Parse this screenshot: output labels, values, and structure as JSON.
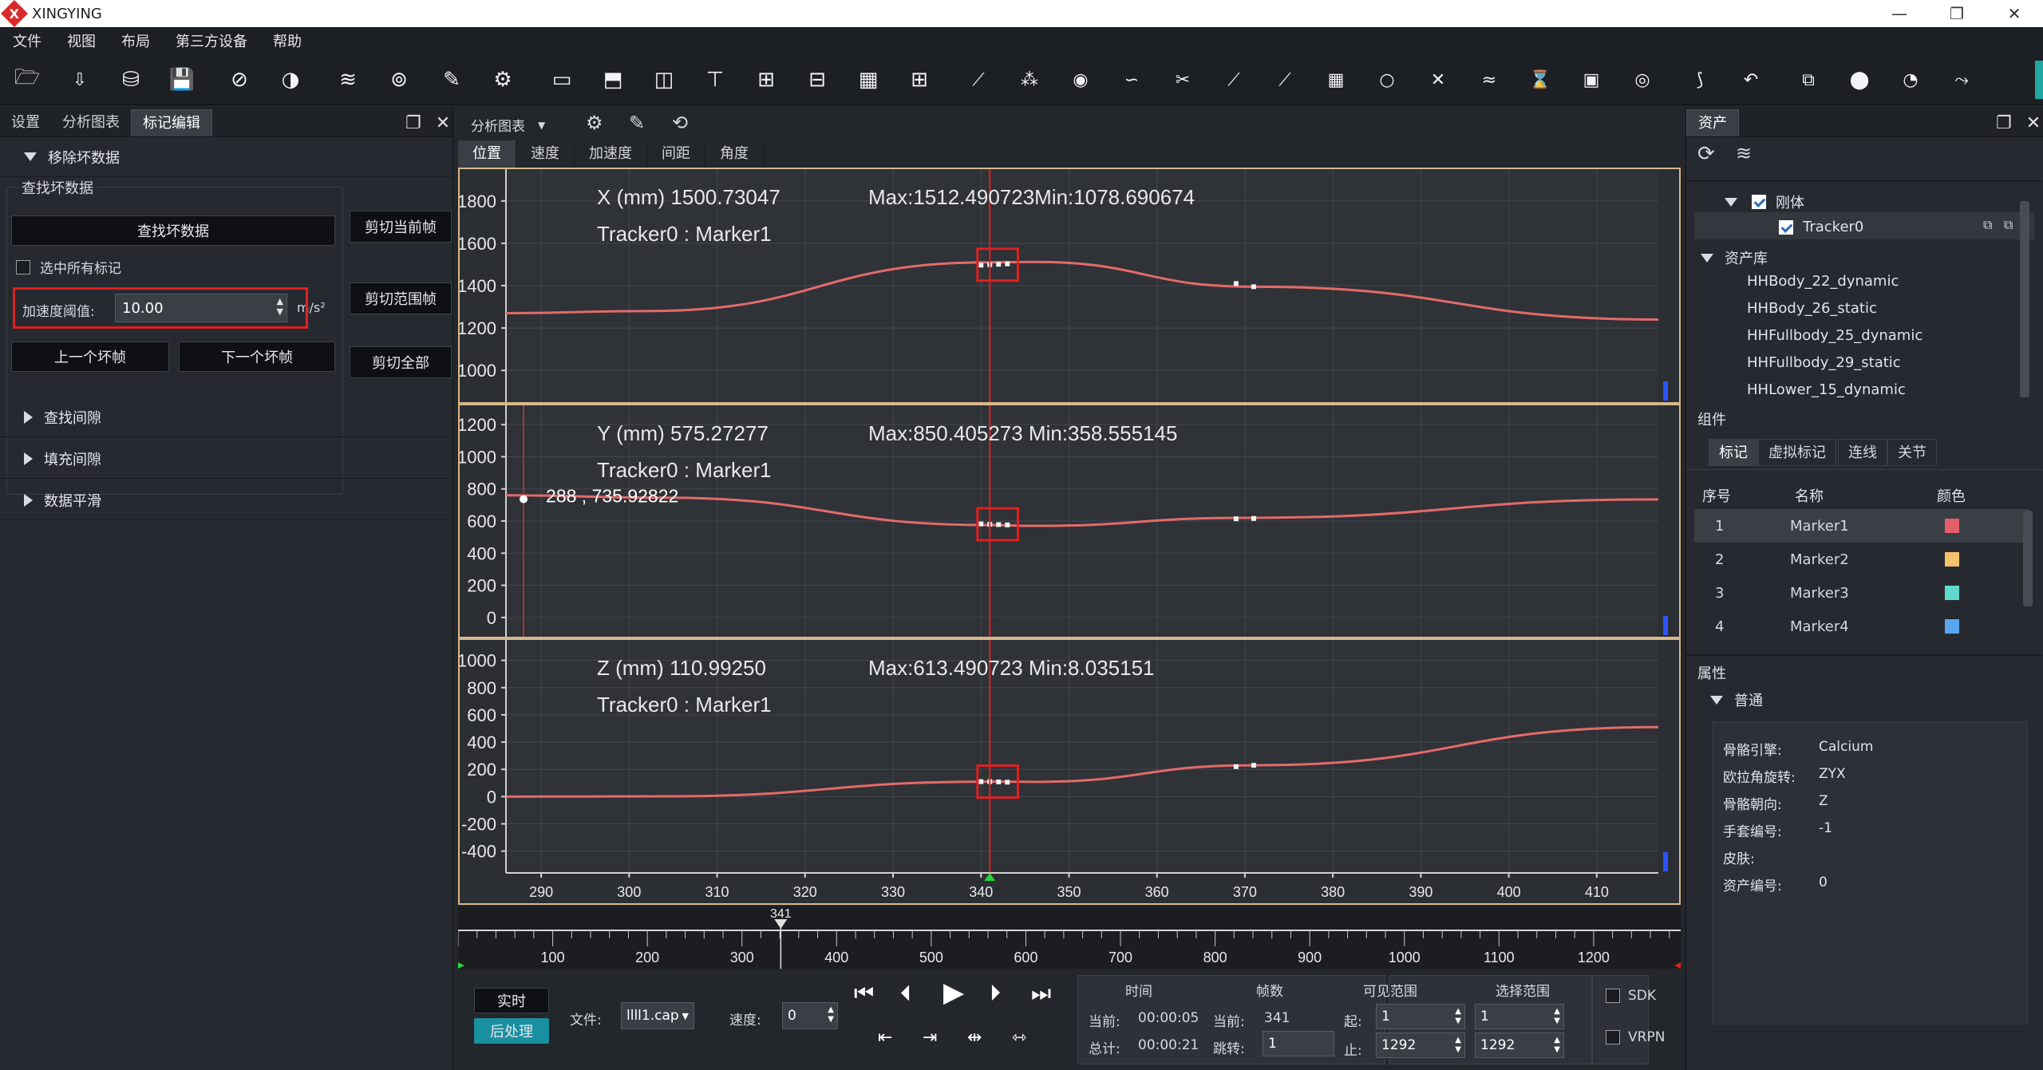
{
  "app": {
    "title": "XINGYING",
    "logo": "X"
  },
  "menu": [
    "文件",
    "视图",
    "布局",
    "第三方设备",
    "帮助"
  ],
  "window_controls": [
    "—",
    "❐",
    "✕"
  ],
  "left_panel": {
    "tabs": [
      "设置",
      "分析图表",
      "标记编辑"
    ],
    "active_tab": 2,
    "remove_bad_section": "移除坏数据",
    "find_bad_group": "查找坏数据",
    "find_bad_button": "查找坏数据",
    "select_all_label": "选中所有标记",
    "accel_threshold_label": "加速度阈值:",
    "accel_threshold_value": "10.00",
    "accel_unit": "m/s²",
    "prev_bad_button": "上一个坏帧",
    "next_bad_button": "下一个坏帧",
    "cut_current_button": "剪切当前帧",
    "cut_range_button": "剪切范围帧",
    "cut_all_button": "剪切全部",
    "find_gap_section": "查找间隙",
    "fill_gap_section": "填充间隙",
    "smooth_section": "数据平滑"
  },
  "center": {
    "chart_select": "分析图表",
    "subtabs": [
      "位置",
      "速度",
      "加速度",
      "间距",
      "角度"
    ],
    "active_subtab": 0
  },
  "chart_data": [
    {
      "type": "line",
      "title": "X (mm) 1500.73047",
      "subtitle": "Tracker0 : Marker1",
      "stats": "Max:1512.490723Min:1078.690674",
      "ylim": [
        850,
        1950
      ],
      "yticks": [
        1000,
        1200,
        1400,
        1600,
        1800
      ],
      "xlim": [
        286,
        417
      ],
      "x": [
        286,
        302,
        341,
        346,
        371,
        417
      ],
      "y": [
        1270,
        1280,
        1510,
        1512,
        1395,
        1240
      ],
      "marker_points": [
        [
          340,
          1497
        ],
        [
          341,
          1499
        ],
        [
          342,
          1501
        ],
        [
          343,
          1503
        ],
        [
          369,
          1410
        ],
        [
          371,
          1395
        ]
      ],
      "cursor_x": 341
    },
    {
      "type": "line",
      "title": "Y (mm) 575.27277",
      "subtitle": "Tracker0 : Marker1",
      "stats": "Max:850.405273  Min:358.555145",
      "ylim": [
        -120,
        1320
      ],
      "yticks": [
        0,
        200,
        400,
        600,
        800,
        1000,
        1200
      ],
      "xlim": [
        286,
        417
      ],
      "x": [
        286,
        304,
        341,
        346,
        370,
        417
      ],
      "y": [
        760,
        745,
        575,
        570,
        620,
        735
      ],
      "marker_points": [
        [
          340,
          582
        ],
        [
          341,
          580
        ],
        [
          342,
          578
        ],
        [
          343,
          576
        ],
        [
          369,
          614
        ],
        [
          371,
          616
        ]
      ],
      "cursor_x": 341,
      "annotation": {
        "x": 288,
        "y": 735.92822,
        "text": "288 , 735.92822"
      }
    },
    {
      "type": "line",
      "title": "Z (mm) 110.99250",
      "subtitle": "Tracker0 : Marker1",
      "stats": "Max:613.490723  Min:8.035151",
      "ylim": [
        -560,
        1150
      ],
      "yticks": [
        -400,
        -200,
        0,
        200,
        400,
        600,
        800,
        1000
      ],
      "xlim": [
        286,
        417
      ],
      "x": [
        286,
        304,
        341,
        346,
        371,
        417
      ],
      "y": [
        0,
        2,
        110,
        108,
        230,
        510
      ],
      "marker_points": [
        [
          340,
          110
        ],
        [
          341,
          110
        ],
        [
          342,
          108
        ],
        [
          343,
          106
        ],
        [
          369,
          220
        ],
        [
          371,
          230
        ]
      ],
      "cursor_x": 341
    }
  ],
  "x_axis": {
    "ticks": [
      290,
      300,
      310,
      320,
      330,
      340,
      350,
      360,
      370,
      380,
      390,
      400,
      410
    ]
  },
  "timeline": {
    "marker": "341",
    "marker_value": 341,
    "range": [
      0,
      1292
    ],
    "ticks": [
      100,
      200,
      300,
      400,
      500,
      600,
      700,
      800,
      900,
      1000,
      1100,
      1200
    ]
  },
  "transport": {
    "realtime_button": "实时",
    "postprocess_button": "后处理",
    "file_label": "文件:",
    "file_value": "llll1.cap",
    "speed_label": "速度:",
    "speed_value": "0",
    "time_header": "时间",
    "frame_header": "帧数",
    "visible_header": "可见范围",
    "select_header": "选择范围",
    "current_label": "当前:",
    "current_time": "00:00:05",
    "total_label": "总计:",
    "total_time": "00:00:21",
    "frame_current_label": "当前:",
    "frame_current": "341",
    "jump_label": "跳转:",
    "jump_value": "1",
    "start_label": "起:",
    "start_value": "1",
    "stop_label": "止:",
    "stop_value": "1292",
    "sel_start": "1",
    "sel_stop": "1292",
    "sdk_label": "SDK",
    "vrpn_label": "VRPN"
  },
  "right_panel": {
    "tab": "资产",
    "rigid_label": "刚体",
    "tracker": "Tracker0",
    "asset_lib": "资产库",
    "assets": [
      "HHBody_22_dynamic",
      "HHBody_26_static",
      "HHFullbody_25_dynamic",
      "HHFullbody_29_static",
      "HHLower_15_dynamic"
    ],
    "component_label": "组件",
    "comp_tabs": [
      "标记",
      "虚拟标记",
      "连线",
      "关节"
    ],
    "table_headers": [
      "序号",
      "名称",
      "颜色"
    ],
    "markers": [
      {
        "idx": "1",
        "name": "Marker1",
        "color": "#e35d6a"
      },
      {
        "idx": "2",
        "name": "Marker2",
        "color": "#f5c36b"
      },
      {
        "idx": "3",
        "name": "Marker3",
        "color": "#5fd8cf"
      },
      {
        "idx": "4",
        "name": "Marker4",
        "color": "#5aa7f0"
      }
    ],
    "props_label": "属性",
    "general_label": "普通",
    "props": [
      {
        "k": "骨骼引擎:",
        "v": "Calcium"
      },
      {
        "k": "欧拉角旋转:",
        "v": "ZYX"
      },
      {
        "k": "骨骼朝向:",
        "v": "Z"
      },
      {
        "k": "手套编号:",
        "v": "-1"
      },
      {
        "k": "皮肤:",
        "v": ""
      },
      {
        "k": "资产编号:",
        "v": "0"
      }
    ]
  },
  "colors": {
    "accent": "#1fa8a3",
    "curve": "#e46a6a",
    "cursor": "#e02020",
    "highlight": "#e02020",
    "frame": "#d8b88a"
  }
}
